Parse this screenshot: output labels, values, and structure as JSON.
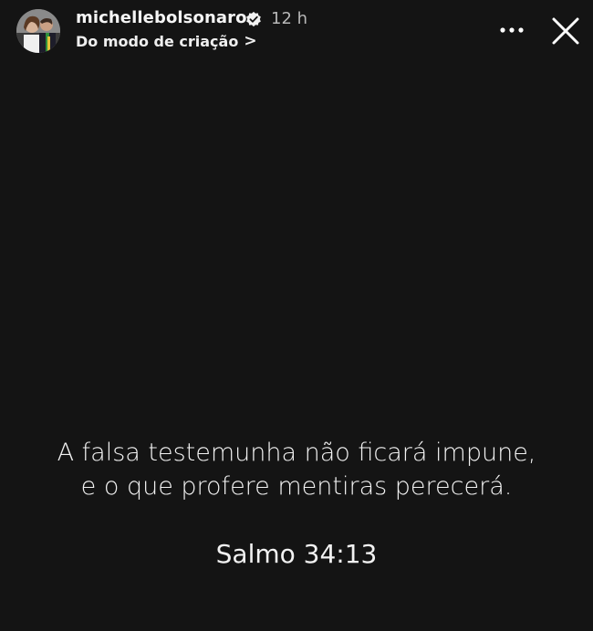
{
  "story": {
    "username": "michellebolsonaro",
    "verified": true,
    "time_ago": "12 h",
    "source_label": "Do modo de criação",
    "source_chevron": ">",
    "more_icon": "more-horizontal-icon",
    "close_icon": "close-icon",
    "background_color": "#141414"
  },
  "content": {
    "quote_line_1": "A falsa testemunha não ficará impune,",
    "quote_line_2": "e o que profere mentiras perecerá.",
    "reference": "Salmo 34:13"
  }
}
